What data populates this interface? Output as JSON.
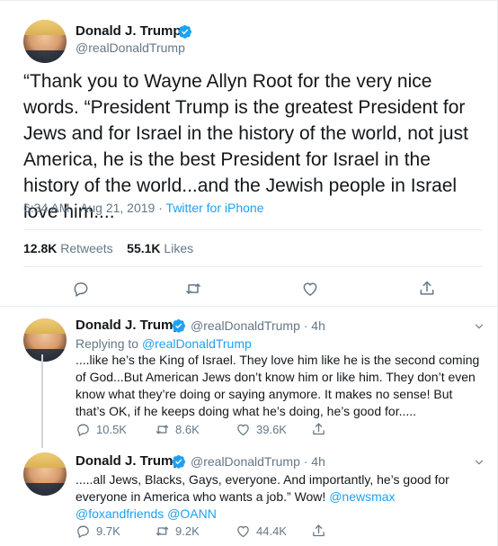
{
  "tweet": {
    "name": "Donald J. Trump",
    "handle": "@realDonaldTrump",
    "text": "“Thank you to Wayne Allyn Root for the very nice words. “President Trump is the greatest President for Jews and for Israel in the history of the world, not just America, he is the best President for Israel in the history of the world...and the Jewish people in Israel love him....",
    "time": "6:34 AM · Aug 21, 2019",
    "separator": " · ",
    "source": "Twitter for iPhone",
    "retweets": "12.8K",
    "retweets_label": "Retweets",
    "likes": "55.1K",
    "likes_label": "Likes"
  },
  "replies": [
    {
      "name": "Donald J. Trump",
      "handle_time": "@realDonaldTrump · 4h",
      "replying_prefix": "Replying to ",
      "replying_to": "@realDonaldTrump",
      "text": "....like he’s the King of Israel. They love him like he is the second coming of God...But American Jews don’t know him or like him. They don’t even know what they’re doing or saying anymore. It makes no sense! But that’s OK, if he keeps doing what he’s doing, he’s good for.....",
      "replies": "10.5K",
      "retweets": "8.6K",
      "likes": "39.6K"
    },
    {
      "name": "Donald J. Trump",
      "handle_time": "@realDonaldTrump · 4h",
      "text_main": ".....all Jews, Blacks, Gays, everyone. And importantly, he’s good for everyone in America who wants a job.” Wow! ",
      "mention1": "@newsmax",
      "mention2": "@foxandfriends",
      "mention3": "@OANN",
      "replies": "9.7K",
      "retweets": "9.2K",
      "likes": "44.4K"
    }
  ],
  "colors": {
    "accent": "#1da1f2",
    "muted": "#657786",
    "border": "#e6ecf0"
  },
  "icons": [
    "verified-badge-icon",
    "reply-icon",
    "retweet-icon",
    "like-icon",
    "share-icon",
    "chevron-down-icon"
  ]
}
